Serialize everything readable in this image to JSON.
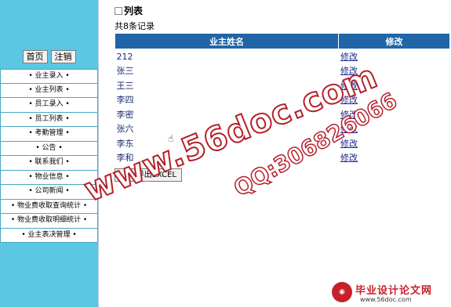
{
  "sidebar": {
    "buttons": {
      "home": "首页",
      "logout": "注销"
    },
    "menu": [
      "• 业主录入 •",
      "• 业主列表 •",
      "• 员工录入 •",
      "• 员工列表 •",
      "• 考勤管理 •",
      "• 公告 •",
      "• 联系我们 •",
      "• 物业信息 •",
      "• 公司新闻 •",
      "• 物业费收取查询统计 •",
      "• 物业费收取明细统计 •",
      "• 业主表决管理 •"
    ]
  },
  "main": {
    "section_title": "列表",
    "record_count": "共8条记录",
    "table": {
      "headers": {
        "name": "业主姓名",
        "edit": "修改"
      },
      "rows": [
        {
          "name": "212",
          "edit": "修改"
        },
        {
          "name": "张三",
          "edit": "修改"
        },
        {
          "name": "王三",
          "edit": "修改"
        },
        {
          "name": "李四",
          "edit": "修改"
        },
        {
          "name": "李密",
          "edit": "修改"
        },
        {
          "name": "张六",
          "edit": "修改"
        },
        {
          "name": "李东",
          "edit": "修改"
        },
        {
          "name": "李和",
          "edit": "修改"
        }
      ]
    },
    "export_button": "导出EXCEL"
  },
  "watermarks": {
    "site": "www.56doc.com",
    "qq": "QQ:306826066",
    "logo_brand": "毕业设计论文网",
    "logo_url": "www.56doc.com"
  },
  "colors": {
    "sidebar_bg": "#5cc7e3",
    "header_bg": "#1f65a7",
    "watermark": "#b51f2a"
  }
}
